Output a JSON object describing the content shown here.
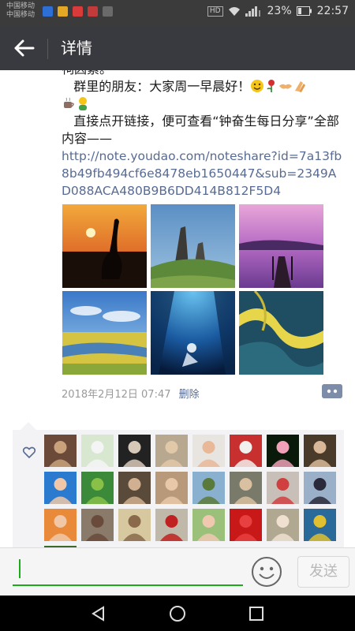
{
  "status_bar": {
    "carrier_1": "中国移动",
    "carrier_2": "中国移动",
    "hd": "HD",
    "battery": "23%",
    "time": "22:57"
  },
  "header": {
    "title": "详情"
  },
  "post": {
    "line_truncated": "祠因素。",
    "greeting": "群里的朋友：大家周一早晨好！",
    "emojis_line1": [
      "smiling-face",
      "rose",
      "handshake",
      "clapping-hands"
    ],
    "emojis_line2": [
      "coffee",
      "smiling-person"
    ],
    "instruction": "直接点开链接，便可查看“钟奋生每日分享”全部内容——",
    "link": "http://note.youdao.com/noteshare?id=7a13fb8b49fb494cf6e8478eb1650447&sub=2349AD088ACA480B9B6DD414B812F5D4",
    "photos": [
      "sunset-crane",
      "rocky-mountain",
      "lake-pier",
      "wetland-sky",
      "underwater-diver",
      "aerial-river"
    ],
    "timestamp": "2018年2月12日 07:47",
    "delete_label": "删除"
  },
  "likes": {
    "avatars": [
      "piano-room",
      "white-cat",
      "portrait-man",
      "man-indoor",
      "woman-portrait",
      "red-building",
      "lotus-flower",
      "woman-piano",
      "woman-smiling",
      "green-figure",
      "man-office",
      "woman-garden",
      "bonsai-tree",
      "man-street",
      "woman-dance",
      "man-suit",
      "woman-red",
      "man-study",
      "group-outdoor",
      "woman-red-dress",
      "woman-field",
      "red-card",
      "old-man",
      "woman-blue",
      "colorful-bird"
    ]
  },
  "input": {
    "send_label": "发送"
  },
  "colors": {
    "accent": "#1aad19",
    "link": "#576b95",
    "appbar": "#393a3f"
  }
}
